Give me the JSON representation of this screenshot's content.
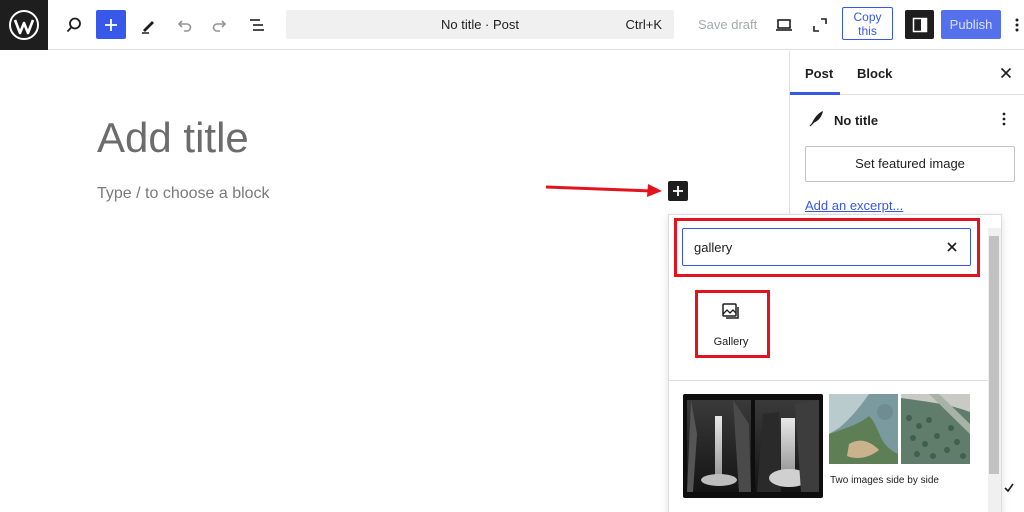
{
  "toolbar": {
    "document_title": "No title · Post",
    "shortcut": "Ctrl+K",
    "save_draft_label": "Save draft",
    "copy_label": "Copy this",
    "publish_label": "Publish",
    "accent_color": "#3858e9"
  },
  "editor": {
    "title_placeholder": "Add title",
    "block_hint": "Type / to choose a block"
  },
  "sidebar": {
    "tabs": [
      {
        "label": "Post",
        "active": true
      },
      {
        "label": "Block",
        "active": false
      }
    ],
    "post_title": "No title",
    "featured_image_label": "Set featured image",
    "excerpt_link": "Add an excerpt..."
  },
  "inserter": {
    "search_value": "gallery",
    "results": [
      {
        "label": "Gallery",
        "icon": "gallery-icon"
      }
    ],
    "patterns": [
      {
        "label": "Two images side by side"
      }
    ],
    "highlight_color": "#e2131c"
  }
}
